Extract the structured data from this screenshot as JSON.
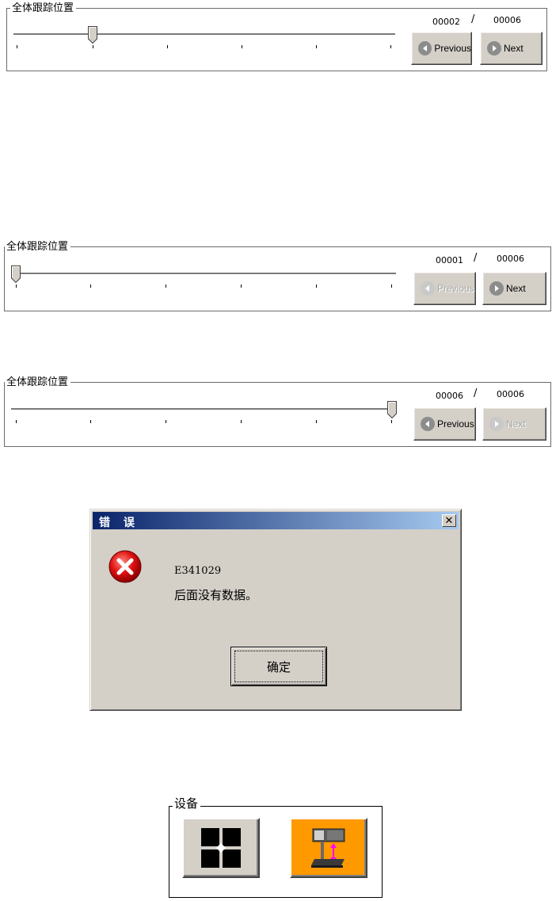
{
  "panels": [
    {
      "title": "全体跟踪位置",
      "current": "00002",
      "separator": "/",
      "total": "00006",
      "slider_value": 2,
      "slider_min": 1,
      "slider_max": 6,
      "previous_label": "Previous",
      "previous_enabled": true,
      "next_label": "Next",
      "next_enabled": true
    },
    {
      "title": "全体跟踪位置",
      "current": "00001",
      "separator": "/",
      "total": "00006",
      "slider_value": 1,
      "slider_min": 1,
      "slider_max": 6,
      "previous_label": "Previous",
      "previous_enabled": false,
      "next_label": "Next",
      "next_enabled": true
    },
    {
      "title": "全体跟踪位置",
      "current": "00006",
      "separator": "/",
      "total": "00006",
      "slider_value": 6,
      "slider_min": 1,
      "slider_max": 6,
      "previous_label": "Previous",
      "previous_enabled": true,
      "next_label": "Next",
      "next_enabled": false
    }
  ],
  "dialog": {
    "title": "错 误",
    "close_label": "✕",
    "icon": "error-icon",
    "code": "E341029",
    "message": "后面没有数据。",
    "ok_label": "确定"
  },
  "device_group": {
    "title": "设备",
    "buttons": [
      {
        "icon": "grid-layout-icon",
        "background": "#d4d0c8"
      },
      {
        "icon": "device-lift-icon",
        "background": "#ff9900"
      }
    ]
  }
}
